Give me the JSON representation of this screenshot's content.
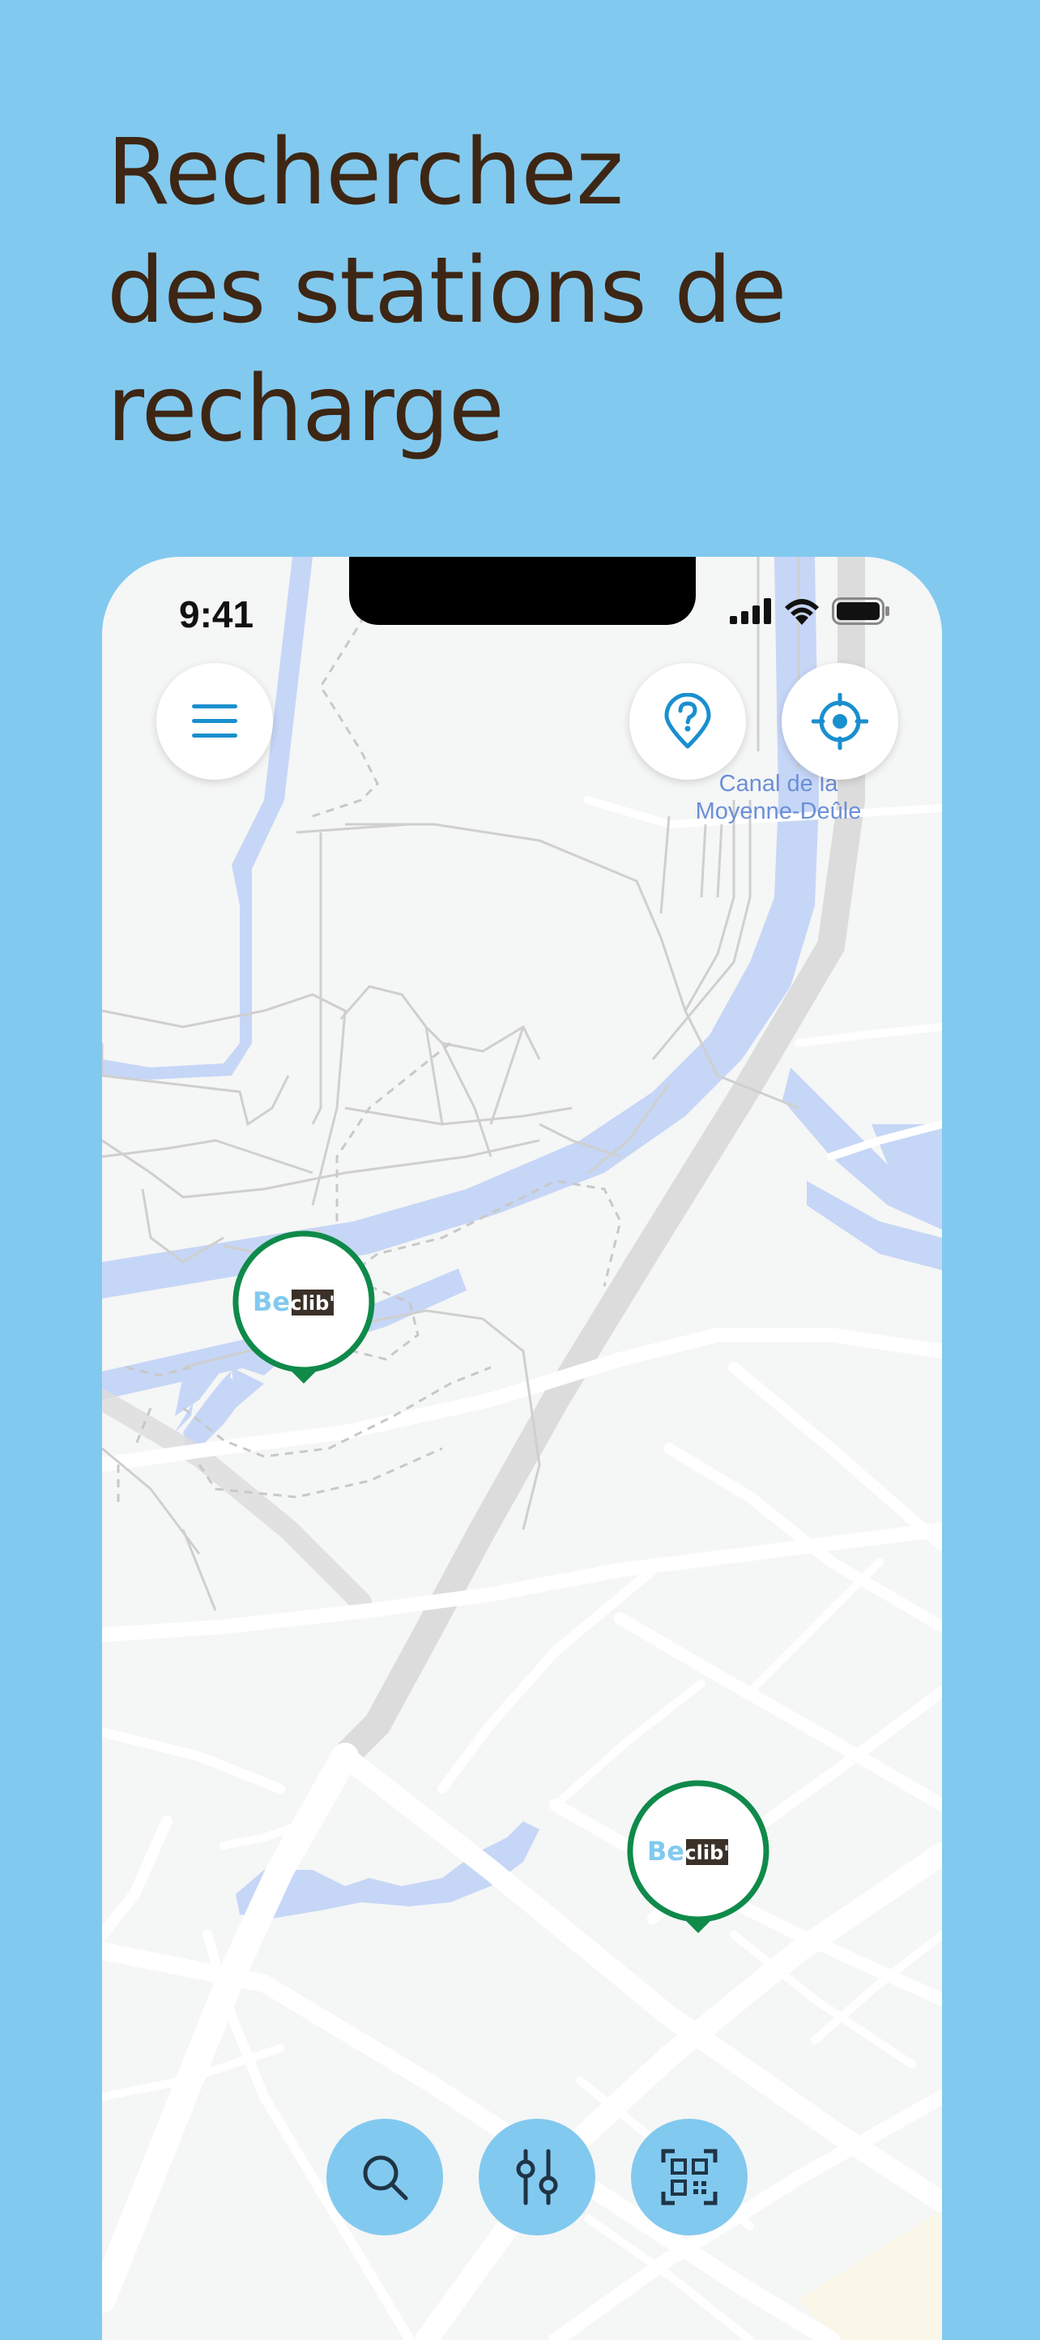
{
  "headline": {
    "line1": "Recherchez",
    "line2": "des stations de",
    "line3": "recharge"
  },
  "status_bar": {
    "time": "9:41"
  },
  "map": {
    "label_line1": "Canal de la",
    "label_line2": "Moyenne-Deûle"
  },
  "markers": [
    {
      "brand_be": "Be",
      "brand_lib": "clib'",
      "color": "#0f8a4a"
    },
    {
      "brand_be": "Be",
      "brand_lib": "clib'",
      "color": "#0f8a4a"
    }
  ],
  "icons": {
    "menu": "menu-icon",
    "help": "help-location-icon",
    "locate": "locate-icon",
    "search": "search-icon",
    "filter": "filter-icon",
    "qr": "qr-code-icon"
  },
  "colors": {
    "background": "#82c9ef",
    "headline": "#3d2614",
    "accent": "#1a8fcf",
    "marker_ring": "#0f8a4a",
    "water": "#c6d6f6"
  }
}
